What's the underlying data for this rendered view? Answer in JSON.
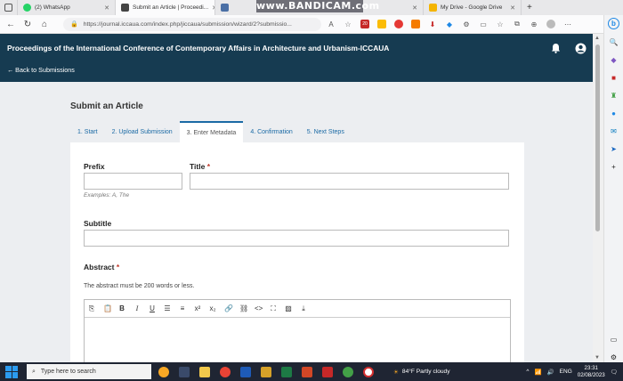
{
  "browser": {
    "tabs": [
      {
        "label": "(2) WhatsApp",
        "icon": "whatsapp-icon",
        "color": "#25d366"
      },
      {
        "label": "Submit an Article | Proceedi...",
        "icon": "pkp-icon",
        "color": "#444444",
        "active": true
      },
      {
        "label": "",
        "icon": "page-icon",
        "color": "#4a6fa5"
      },
      {
        "label": "My Drive - Google Drive",
        "icon": "drive-icon",
        "color": "#f4b400"
      }
    ],
    "watermark": "www.BANDICAM.com",
    "url": "https://journal.iccaua.com/index.php/jiccaua/submission/wizard/2?submissio..."
  },
  "app": {
    "title": "Proceedings of the International Conference of Contemporary Affairs in Architecture and Urbanism-ICCAUA",
    "back_link": "← Back to Submissions"
  },
  "page": {
    "title": "Submit an Article",
    "steps": [
      "1. Start",
      "2. Upload Submission",
      "3. Enter Metadata",
      "4. Confirmation",
      "5. Next Steps"
    ],
    "active_step": 2
  },
  "form": {
    "prefix_label": "Prefix",
    "prefix_value": "",
    "prefix_hint": "Examples: A, The",
    "title_label": "Title",
    "title_value": "",
    "subtitle_label": "Subtitle",
    "subtitle_value": "",
    "abstract_label": "Abstract",
    "abstract_desc": "The abstract must be 200 words or less.",
    "required_mark": "*"
  },
  "taskbar": {
    "search_placeholder": "Type here to search",
    "weather": "84°F  Partly cloudy",
    "lang": "ENG",
    "time": "23:31",
    "date": "02/08/2023"
  },
  "colors": {
    "header_bg": "#163b51",
    "link": "#1b6aa5",
    "required": "#c0392b"
  }
}
